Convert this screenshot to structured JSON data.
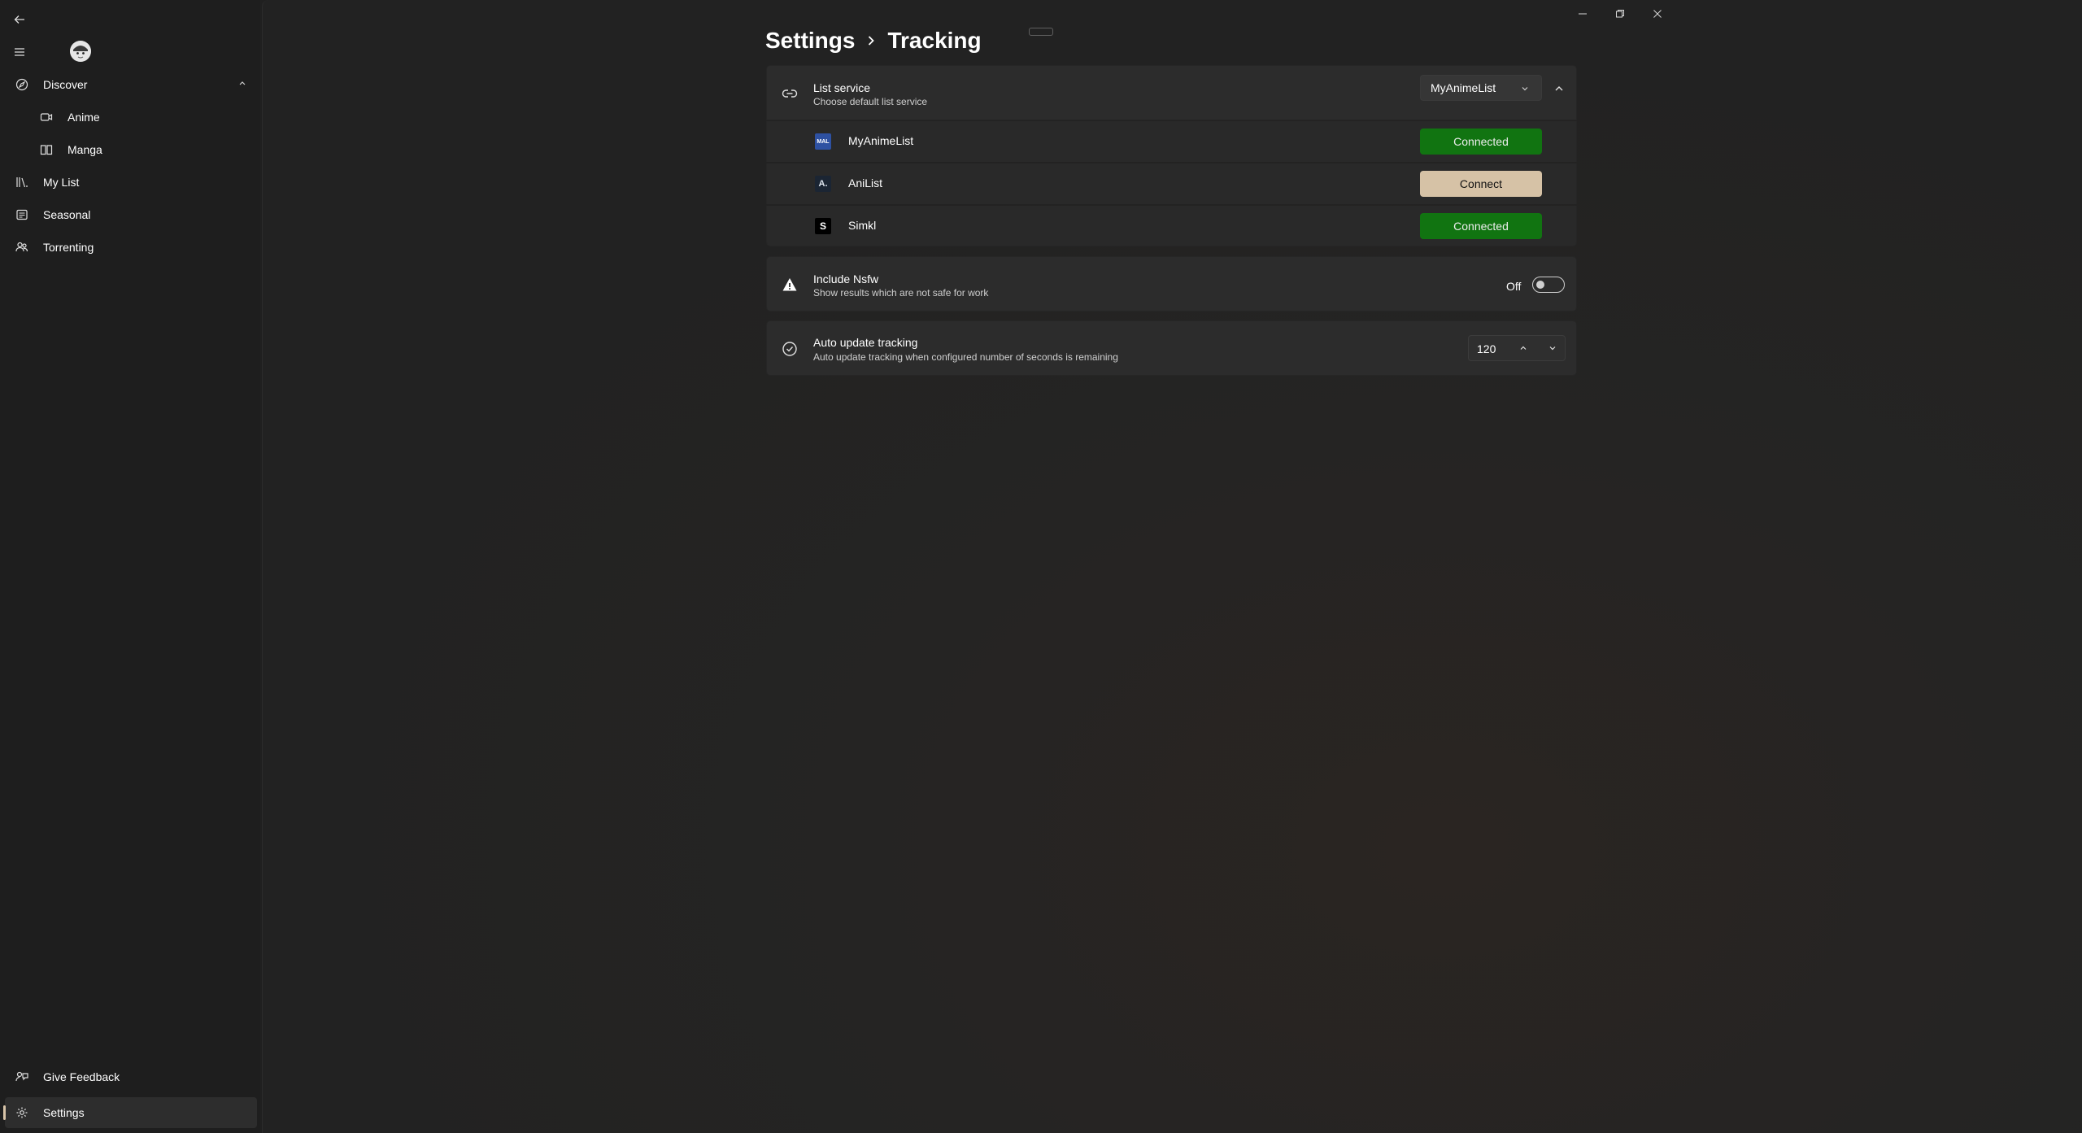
{
  "sidebar": {
    "items": [
      {
        "label": "Discover",
        "icon": "discover-icon"
      },
      {
        "label": "Anime",
        "icon": "video-icon"
      },
      {
        "label": "Manga",
        "icon": "book-icon"
      },
      {
        "label": "My List",
        "icon": "library-icon"
      },
      {
        "label": "Seasonal",
        "icon": "calendar-icon"
      },
      {
        "label": "Torrenting",
        "icon": "people-icon"
      }
    ],
    "footer": [
      {
        "label": "Give Feedback",
        "icon": "feedback-icon"
      },
      {
        "label": "Settings",
        "icon": "gear-icon"
      }
    ]
  },
  "breadcrumb": {
    "root": "Settings",
    "current": "Tracking"
  },
  "list_service": {
    "title": "List service",
    "description": "Choose default list service",
    "selected": "MyAnimeList",
    "services": [
      {
        "name": "MyAnimeList",
        "logo": "MAL",
        "button": "Connected",
        "status": "connected",
        "logo_color": "#2e51a2"
      },
      {
        "name": "AniList",
        "logo": "A.",
        "button": "Connect",
        "status": "disconnected",
        "logo_color": "#1b2533"
      },
      {
        "name": "Simkl",
        "logo": "S",
        "button": "Connected",
        "status": "connected",
        "logo_color": "#000000"
      }
    ]
  },
  "nsfw": {
    "title": "Include Nsfw",
    "description": "Show results which are not safe for work",
    "state_label": "Off"
  },
  "auto_update": {
    "title": "Auto update tracking",
    "description": "Auto update tracking when configured number of seconds is remaining",
    "value": "120"
  },
  "colors": {
    "accent": "#d6c2a6",
    "connected": "#0f7b0f",
    "background": "#202020"
  }
}
